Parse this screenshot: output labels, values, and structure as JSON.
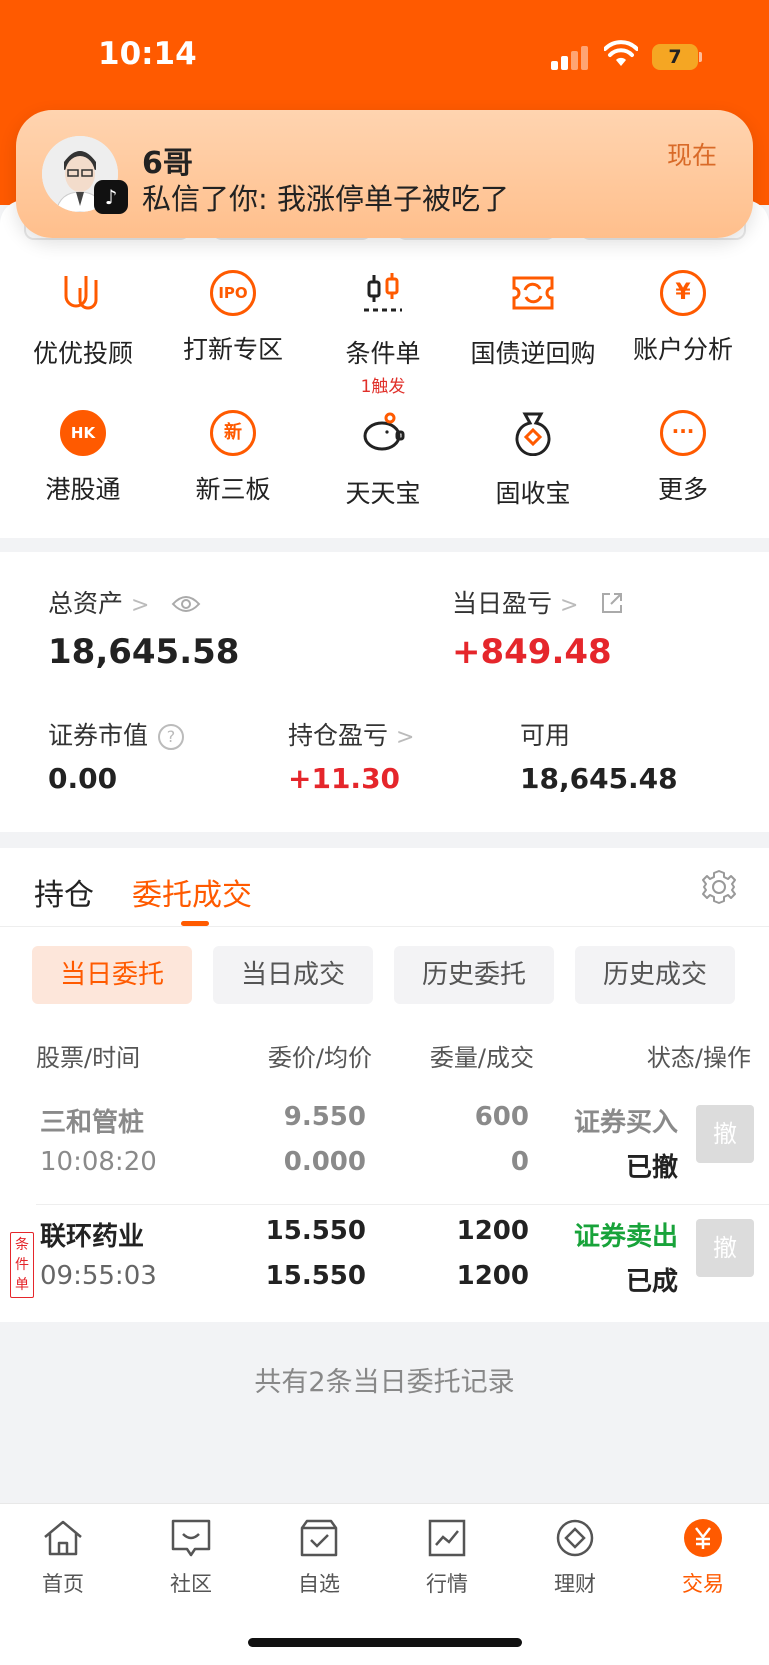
{
  "status_bar": {
    "time": "10:14",
    "battery": "7"
  },
  "notification": {
    "title": "6哥",
    "body": "私信了你: 我涨停单子被吃了",
    "time": "现在",
    "app_icon": "tiktok-icon"
  },
  "shortcuts": [
    {
      "label": "优优投顾",
      "icon": "uu-advisor-icon",
      "glyph": "U"
    },
    {
      "label": "打新专区",
      "icon": "ipo-icon",
      "glyph": "IPO"
    },
    {
      "label": "条件单",
      "icon": "condition-order-icon",
      "glyph": "",
      "sub": "1触发"
    },
    {
      "label": "国债逆回购",
      "icon": "reverse-repo-icon",
      "glyph": "⟳"
    },
    {
      "label": "账户分析",
      "icon": "account-analysis-icon",
      "glyph": "¥"
    },
    {
      "label": "港股通",
      "icon": "hk-connect-icon",
      "glyph": "HK"
    },
    {
      "label": "新三板",
      "icon": "neeq-icon",
      "glyph": "新"
    },
    {
      "label": "天天宝",
      "icon": "piggy-bank-icon",
      "glyph": ""
    },
    {
      "label": "固收宝",
      "icon": "money-bag-icon",
      "glyph": ""
    },
    {
      "label": "更多",
      "icon": "more-icon",
      "glyph": "···"
    }
  ],
  "assets": {
    "total_label": "总资产",
    "total_value": "18,645.58",
    "daily_pl_label": "当日盈亏",
    "daily_pl_value": "+849.48",
    "market_value_label": "证券市值",
    "market_value": "0.00",
    "position_pl_label": "持仓盈亏",
    "position_pl_value": "+11.30",
    "available_label": "可用",
    "available_value": "18,645.48"
  },
  "orders": {
    "tabs": [
      "持仓",
      "委托成交"
    ],
    "active_tab": "委托成交",
    "subtabs": [
      "当日委托",
      "当日成交",
      "历史委托",
      "历史成交"
    ],
    "columns": [
      "股票/时间",
      "委价/均价",
      "委量/成交",
      "状态/操作"
    ],
    "rows": [
      {
        "name": "三和管桩",
        "time": "10:08:20",
        "price": "9.550",
        "avg_price": "0.000",
        "qty": "600",
        "filled": "0",
        "side": "证券买入",
        "status": "已撤",
        "action": "撤",
        "tag": ""
      },
      {
        "name": "联环药业",
        "time": "09:55:03",
        "price": "15.550",
        "avg_price": "15.550",
        "qty": "1200",
        "filled": "1200",
        "side": "证券卖出",
        "status": "已成",
        "action": "撤",
        "tag": "条件单"
      }
    ],
    "footer": "共有2条当日委托记录"
  },
  "bottom_nav": [
    {
      "label": "首页",
      "icon": "home-icon"
    },
    {
      "label": "社区",
      "icon": "community-icon"
    },
    {
      "label": "自选",
      "icon": "watchlist-icon"
    },
    {
      "label": "行情",
      "icon": "market-icon"
    },
    {
      "label": "理财",
      "icon": "wealth-icon"
    },
    {
      "label": "交易",
      "icon": "trade-icon",
      "active": true
    }
  ],
  "colors": {
    "accent": "#ff5a00",
    "up_red": "#e5262b",
    "sell_green": "#18a33a"
  }
}
